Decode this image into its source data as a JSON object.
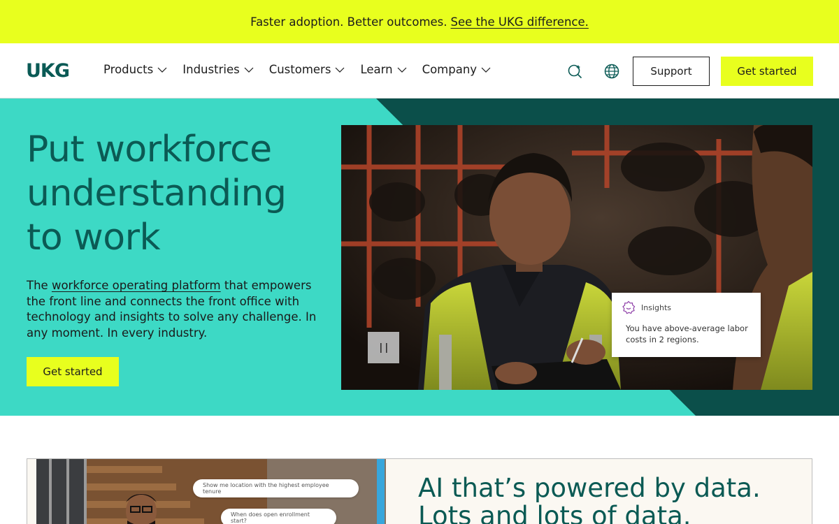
{
  "promo": {
    "text": "Faster adoption. Better outcomes.",
    "link": "See the UKG difference."
  },
  "header": {
    "logo": "UKG",
    "nav": [
      {
        "label": "Products"
      },
      {
        "label": "Industries"
      },
      {
        "label": "Customers"
      },
      {
        "label": "Learn"
      },
      {
        "label": "Company"
      }
    ],
    "support_label": "Support",
    "get_started_label": "Get started"
  },
  "hero": {
    "title": "Put workforce understanding to work",
    "desc_before": "The",
    "desc_link": "workforce operating platform",
    "desc_after": "that empowers the front line and connects the front office with technology and insights to solve any challenge. In any moment. In every industry.",
    "cta_label": "Get started",
    "insight": {
      "label": "Insights",
      "text": "You have above-average labor costs in 2 regions."
    }
  },
  "lower": {
    "title": "AI that’s powered by data. Lots and lots of data.",
    "chat": [
      "Show me location with the highest employee tenure",
      "When does open enrollment start?"
    ]
  },
  "colors": {
    "accent_yellow": "#e8ff1e",
    "hero_teal": "#3dd9c5",
    "dark_teal": "#0b4f4a",
    "brand_green": "#0a5a55"
  },
  "icons": [
    "search-icon",
    "globe-icon",
    "chevron-down-icon",
    "pause-icon",
    "insights-icon"
  ]
}
